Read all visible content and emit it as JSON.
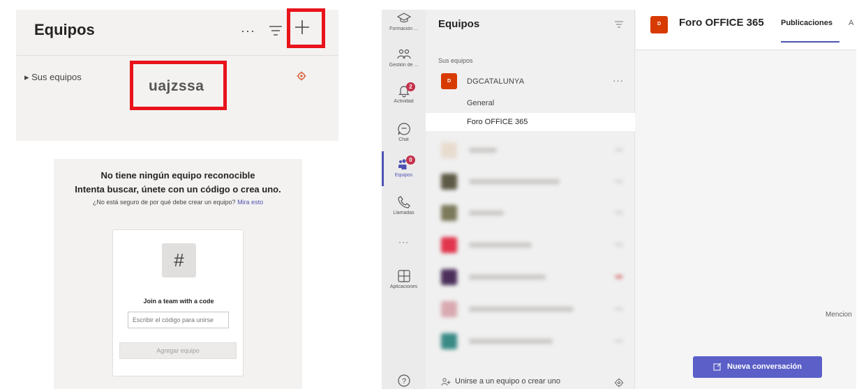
{
  "panel_a": {
    "title": "Equipos",
    "more_label": "···",
    "tree_label": "▸  Sus equipos",
    "team_code": "uajzssa"
  },
  "panel_b": {
    "heading_line1": "No tiene ningún equipo reconocible",
    "heading_line2": "Intenta buscar, únete con un código o crea uno.",
    "help_text": "¿No está seguro de por qué debe crear un equipo?",
    "help_link": "Mira esto",
    "hash_glyph": "#",
    "join_title": "Join a team with a code",
    "code_placeholder": "Escribir el código para unirse",
    "add_button": "Agregar equipo"
  },
  "rail": {
    "items": [
      {
        "label": "Formación ..."
      },
      {
        "label": "Gestión de ..."
      },
      {
        "label": "Actividad",
        "badge": "2"
      },
      {
        "label": "Chat"
      },
      {
        "label": "Equipos",
        "badge": "0"
      },
      {
        "label": "Llamadas"
      },
      {
        "label": "···"
      },
      {
        "label": "Aplicaciones"
      }
    ],
    "help_icon": "?"
  },
  "teams_list": {
    "title": "Equipos",
    "section_label": "Sus equipos",
    "team": {
      "avatar": "D",
      "name": "DGCATALUNYA",
      "more": "···",
      "channels": [
        "General",
        "Foro OFFICE 365"
      ]
    },
    "join_label": "Unirse a un equipo o crear uno"
  },
  "channel": {
    "avatar": "D",
    "title": "Foro OFFICE 365",
    "tab_active": "Publicaciones",
    "tab_next": "A",
    "mention_text": "Mencion",
    "new_conversation_button": "Nueva conversación"
  },
  "colors": {
    "highlight_red": "#e8131b",
    "accent_purple": "#5b5fc7",
    "team_orange": "#d83b01"
  }
}
